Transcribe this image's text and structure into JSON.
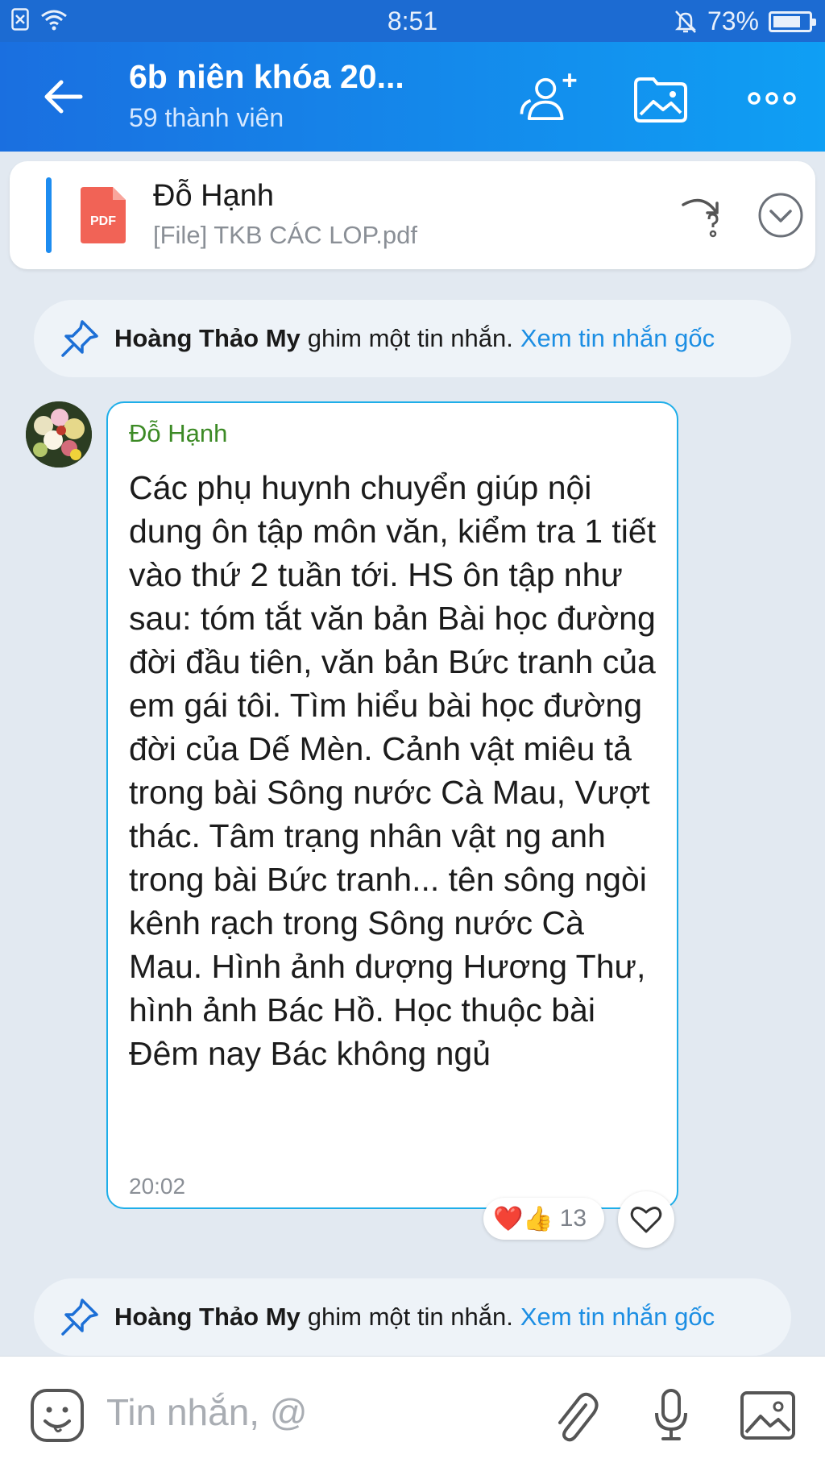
{
  "status_bar": {
    "time": "8:51",
    "battery": "73%",
    "battery_level": 0.73
  },
  "header": {
    "title": "6b niên khóa 20...",
    "subtitle": "59 thành viên"
  },
  "pinned_message": {
    "sender": "Đỗ Hạnh",
    "file_label": "[File] TKB CÁC LOP.pdf",
    "pdf_badge": "PDF"
  },
  "notices": [
    {
      "who": "Hoàng Thảo My",
      "action": "ghim một tin nhắn.",
      "link": "Xem tin nhắn gốc"
    },
    {
      "who": "Hoàng Thảo My",
      "action": "ghim một tin nhắn.",
      "link": "Xem tin nhắn gốc"
    }
  ],
  "message": {
    "sender": "Đỗ Hạnh",
    "text": "Các phụ huynh chuyển giúp nội dung ôn tập môn văn, kiểm tra 1 tiết vào thứ 2 tuần tới. HS ôn tập như sau: tóm tắt văn bản Bài học đường đời đầu tiên, văn bản Bức tranh của em gái tôi. Tìm hiểu bài học đường đời của Dế Mèn. Cảnh vật miêu tả trong bài Sông nước Cà Mau, Vượt thác. Tâm trạng nhân vật ng anh trong bài Bức tranh... tên sông ngòi kênh rạch trong Sông nước Cà Mau. Hình ảnh dượng Hương Thư, hình ảnh Bác Hồ. Học thuộc bài Đêm nay Bác không ngủ",
    "time": "20:02",
    "reactions": {
      "emojis": "❤️👍",
      "count": "13"
    }
  },
  "composer": {
    "placeholder": "Tin nhắn, @"
  },
  "colors": {
    "accent": "#1a6fe0",
    "link": "#1c8ee3",
    "sender_green": "#3c8a25",
    "bubble_border": "#1eaee9"
  }
}
